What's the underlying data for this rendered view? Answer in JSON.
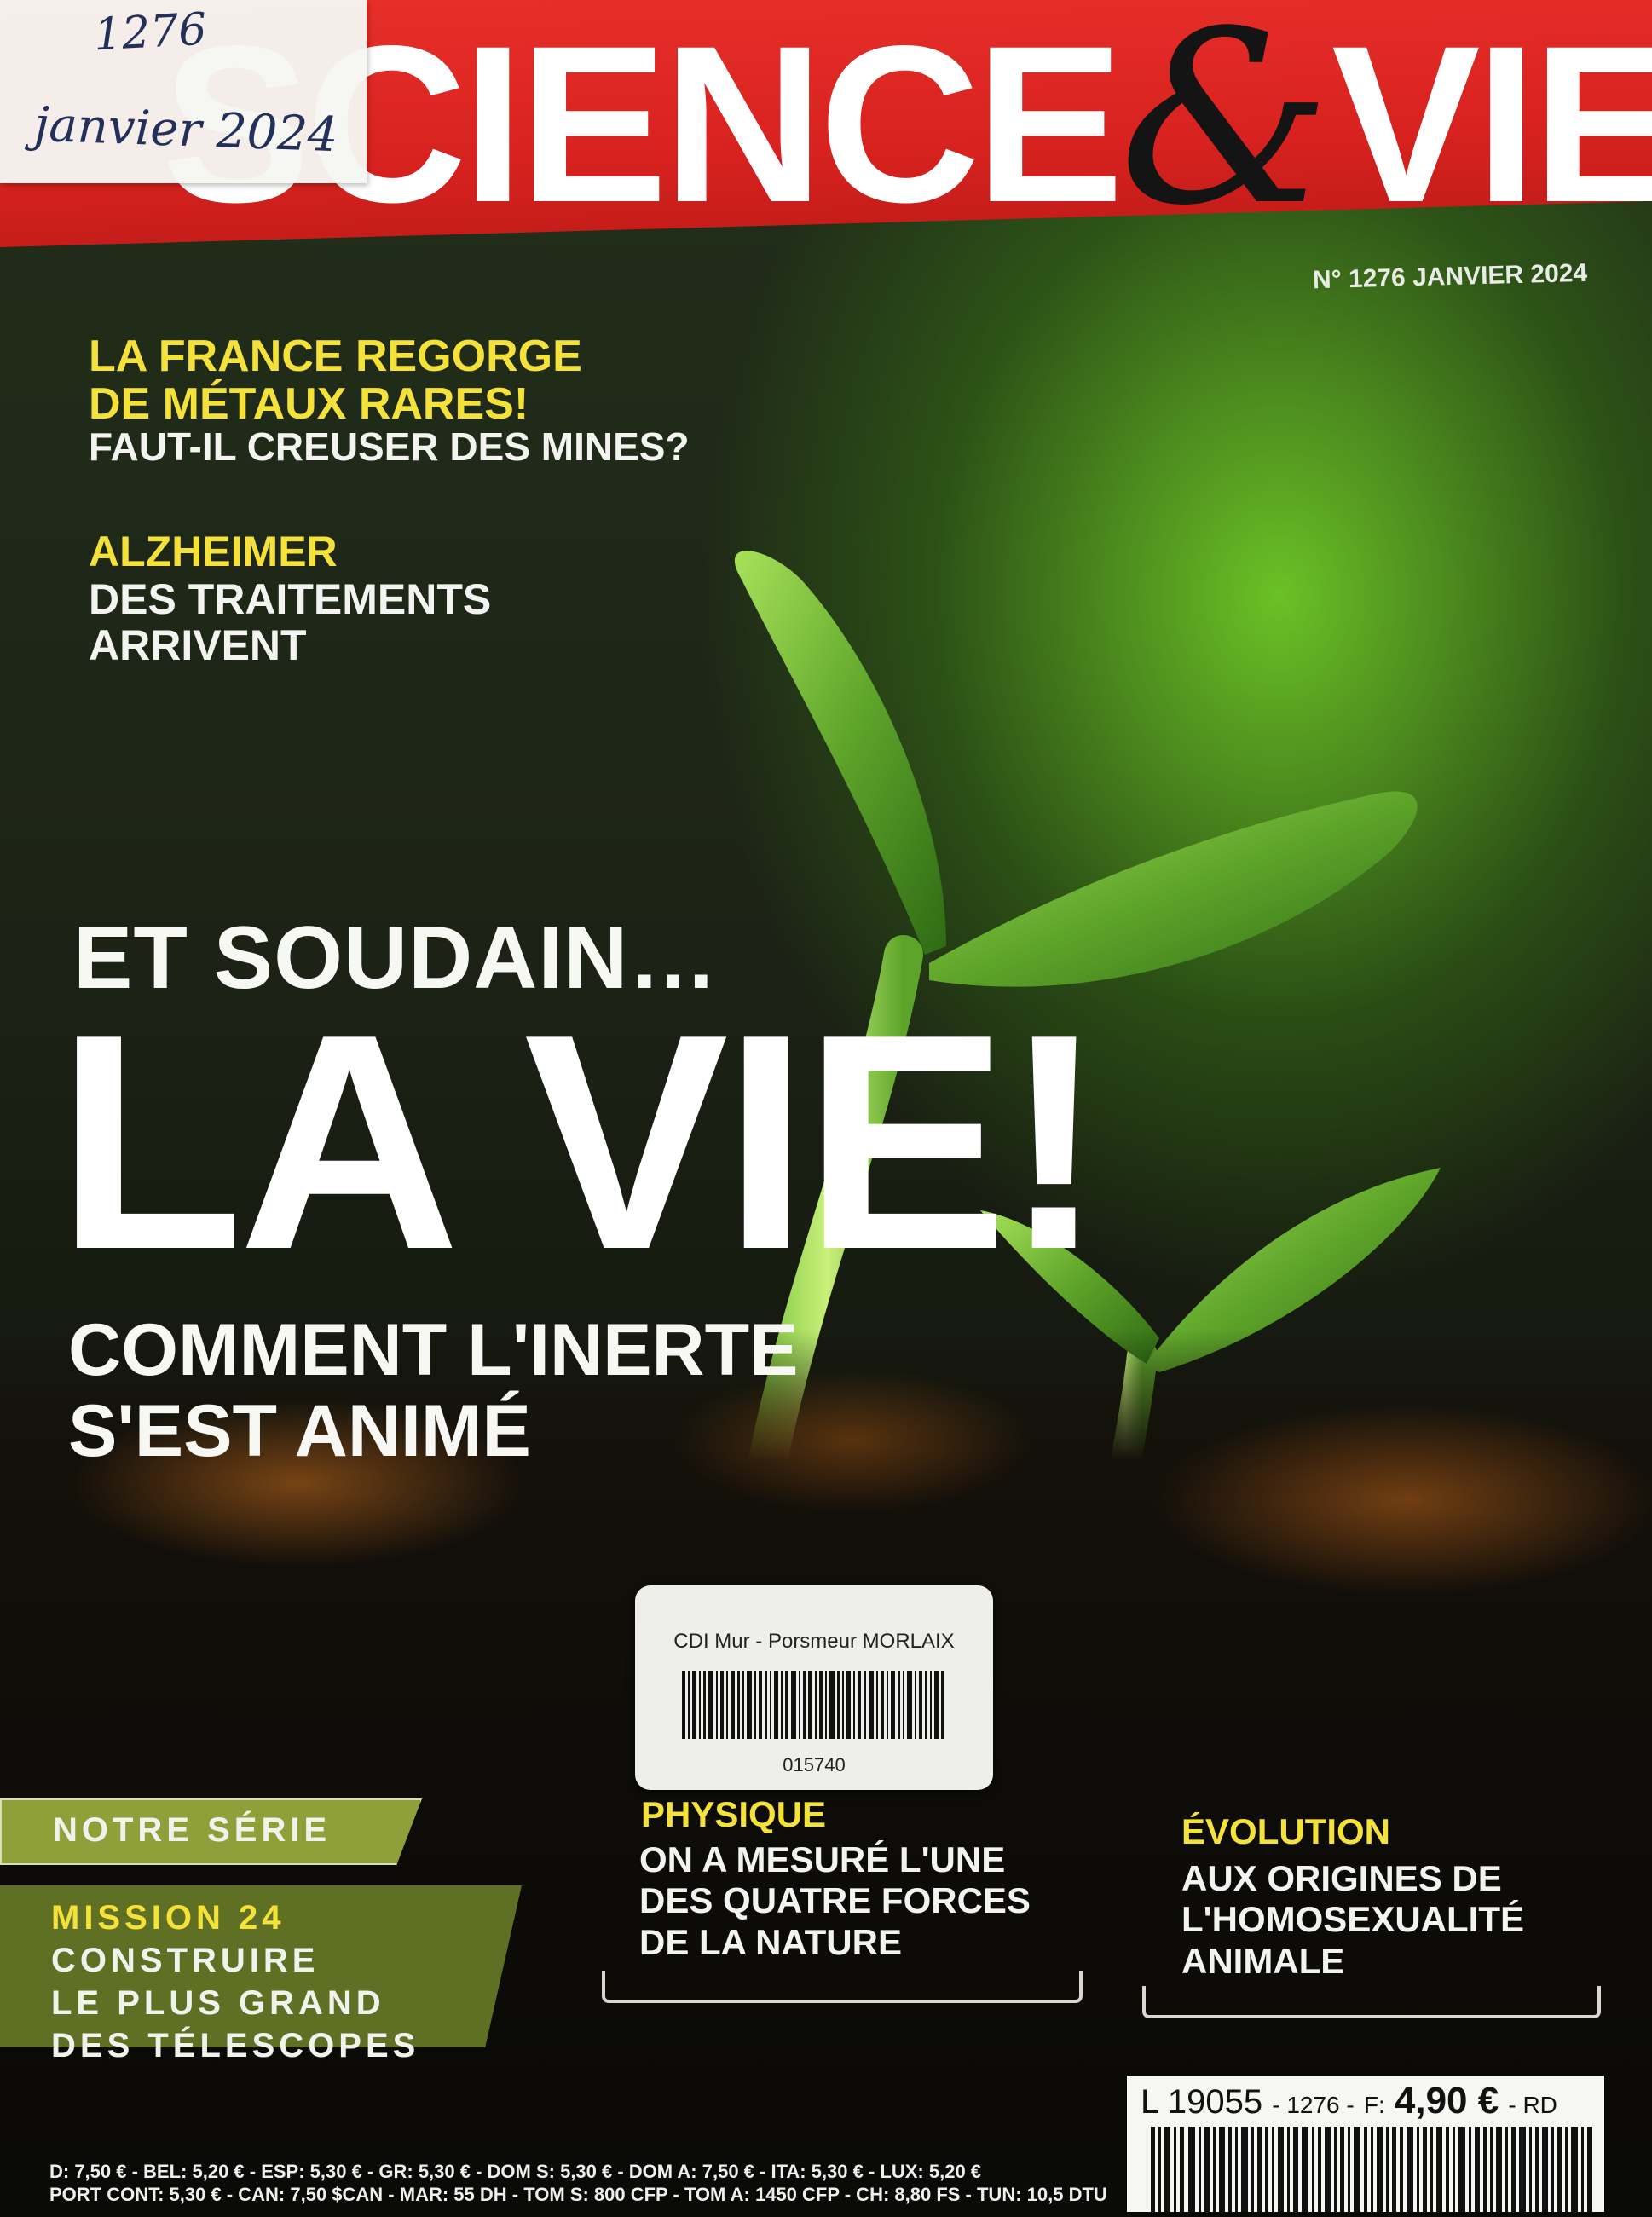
{
  "masthead": {
    "title_part1": "SCIENCE",
    "title_amp": "&",
    "title_part2": "VIE",
    "color": "#d8221f",
    "handwritten_number": "1276",
    "handwritten_date": "janvier 2024"
  },
  "issue": {
    "label": "N° 1276 JANVIER 2024"
  },
  "coverlines": {
    "metals_line1": "LA FRANCE REGORGE",
    "metals_line2": "DE MÉTAUX RARES!",
    "metals_sub": "FAUT-IL CREUSER DES MINES?",
    "alz_title": "ALZHEIMER",
    "alz_line1": "DES TRAITEMENTS",
    "alz_line2": "ARRIVENT"
  },
  "headline": {
    "kicker": "ET SOUDAIN…",
    "main": "LA VIE!",
    "sub1": "COMMENT L'INERTE",
    "sub2": "S'EST ANIMÉ"
  },
  "sticker": {
    "library": "CDI Mur - Porsmeur MORLAIX",
    "code": "015740"
  },
  "series": {
    "tag": "NOTRE SÉRIE",
    "mission": "MISSION 24",
    "line1": "CONSTRUIRE",
    "line2": "LE PLUS GRAND",
    "line3": "DES TÉLESCOPES"
  },
  "physique": {
    "title": "PHYSIQUE",
    "line1": "ON A MESURÉ L'UNE",
    "line2": "DES QUATRE FORCES",
    "line3": "DE LA NATURE"
  },
  "evolution": {
    "title": "ÉVOLUTION",
    "line1": "AUX ORIGINES DE",
    "line2": "L'HOMOSEXUALITÉ",
    "line3": "ANIMALE"
  },
  "price": {
    "code": "L 19055",
    "issue": "- 1276 -",
    "country": "F:",
    "amount": "4,90 €",
    "suffix": "- RD"
  },
  "fine_print": {
    "line1": "D: 7,50 € - BEL: 5,20 € - ESP: 5,30 € - GR: 5,30 € - DOM S: 5,30 € - DOM A: 7,50 € - ITA: 5,30 € - LUX: 5,20 €",
    "line2": "PORT CONT: 5,30 € - CAN: 7,50 $CAN - MAR: 55 DH - TOM S: 800 CFP - TOM A: 1450 CFP - CH: 8,80 FS - TUN: 10,5 DTU"
  },
  "colors": {
    "accent_yellow": "#f4e23a",
    "series_green": "#5f6f24",
    "background_green": "#3f7a1a"
  }
}
